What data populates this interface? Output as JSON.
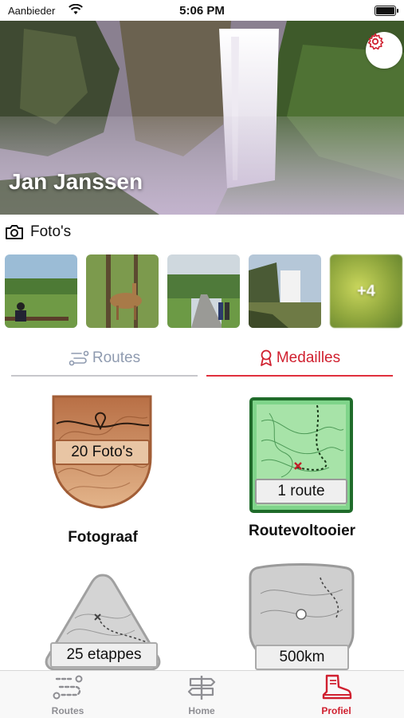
{
  "status": {
    "carrier": "Aanbieder",
    "time": "5:06 PM"
  },
  "profile": {
    "name": "Jan Janssen"
  },
  "photos": {
    "title": "Foto's",
    "more_count": "+4"
  },
  "tabs": {
    "routes": "Routes",
    "medals": "Medailles",
    "active": "medals"
  },
  "medals": [
    {
      "title": "Fotograaf",
      "badge": "20 Foto's",
      "tier": "bronze"
    },
    {
      "title": "Routevoltooier",
      "badge": "1 route",
      "tier": "green"
    },
    {
      "title": "",
      "badge": "25 etappes",
      "tier": "locked"
    },
    {
      "title": "",
      "badge": "500km",
      "tier": "locked"
    }
  ],
  "tabbar": [
    {
      "label": "Routes",
      "icon": "routes-icon"
    },
    {
      "label": "Home",
      "icon": "signpost-icon"
    },
    {
      "label": "Profiel",
      "icon": "boot-icon",
      "active": true
    }
  ],
  "colors": {
    "accent": "#d0202f",
    "inactive": "#8e8e93",
    "bronze": "#c27a52",
    "green": "#2e7d32"
  }
}
